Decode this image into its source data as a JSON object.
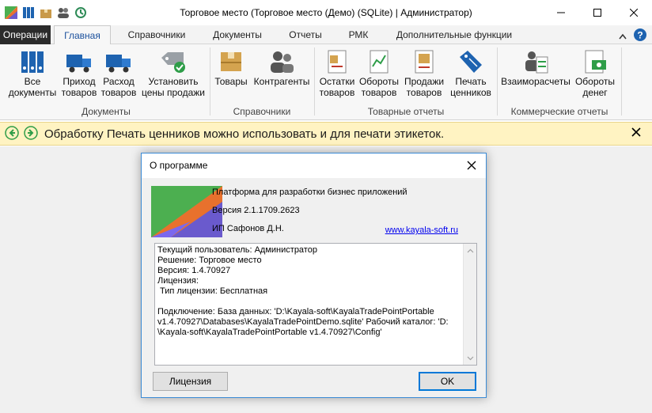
{
  "window": {
    "title": "Торговое место (Торговое место (Демо) (SQLite) | Администратор)"
  },
  "tabs": {
    "operations": "Операции",
    "items": [
      "Главная",
      "Справочники",
      "Документы",
      "Отчеты",
      "РМК",
      "Дополнительные функции"
    ],
    "active": "Главная"
  },
  "ribbon": {
    "groups": {
      "documents": "Документы",
      "directories": "Справочники",
      "goods_reports": "Товарные отчеты",
      "commercial_reports": "Коммерческие отчеты"
    },
    "buttons": {
      "all_docs": "Все\nдокументы",
      "goods_in": "Приход\nтоваров",
      "goods_out": "Расход\nтоваров",
      "set_prices": "Установить\nцены продажи",
      "goods": "Товары",
      "contractors": "Контрагенты",
      "stock": "Остатки\nтоваров",
      "turnover": "Обороты\nтоваров",
      "sales": "Продажи\nтоваров",
      "print_tags": "Печать\nценников",
      "mutual": "Взаиморасчеты",
      "money": "Обороты\nденег"
    }
  },
  "infobar": {
    "message": "Обработку Печать ценников можно использовать и для печати этикеток."
  },
  "about": {
    "title": "О программе",
    "platform": "Платформа для разработки бизнес приложений",
    "version": "Версия 2.1.1709.2623",
    "author": "ИП Сафонов Д.Н.",
    "link": "www.kayala-soft.ru",
    "info_lines": [
      "Текущий пользователь: Администратор",
      "Решение: Торговое место",
      "Версия: 1.4.70927",
      "Лицензия:",
      " Тип лицензии: Бесплатная",
      "",
      "Подключение: База данных: 'D:\\Kayala-soft\\KayalaTradePointPortable",
      "v1.4.70927\\Databases\\KayalaTradePointDemo.sqlite' Рабочий каталог: 'D:",
      "\\Kayala-soft\\KayalaTradePointPortable v1.4.70927\\Config'"
    ],
    "license_button": "Лицензия",
    "ok_button": "OK"
  },
  "colors": {
    "accent": "#1a4f9c",
    "infobar_bg": "#fff3c2",
    "dialog_border": "#3b8bd6"
  }
}
